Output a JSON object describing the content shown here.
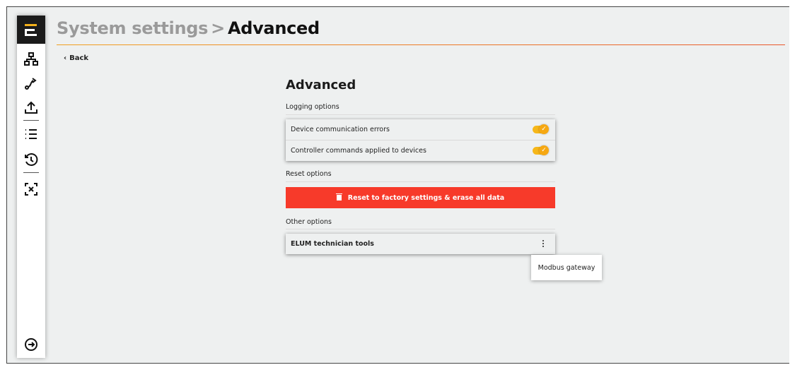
{
  "header": {
    "breadcrumb_parent": "System settings",
    "breadcrumb_separator": ">",
    "breadcrumb_current": "Advanced",
    "back_label": "Back",
    "back_icon": "chevron-left-icon"
  },
  "sidebar": {
    "logo": "E",
    "items": [
      {
        "icon": "network-hierarchy-icon"
      },
      {
        "icon": "route-icon"
      },
      {
        "icon": "upload-icon"
      },
      {
        "icon": "list-icon"
      },
      {
        "icon": "history-timer-icon"
      },
      {
        "icon": "scan-focus-icon"
      },
      {
        "icon": "logout-icon"
      }
    ]
  },
  "main": {
    "title": "Advanced",
    "logging": {
      "label": "Logging options",
      "items": [
        {
          "label": "Device communication errors",
          "enabled": true
        },
        {
          "label": "Controller commands applied to devices",
          "enabled": true
        }
      ]
    },
    "reset": {
      "label": "Reset options",
      "button_label": "Reset to factory settings & erase all data"
    },
    "other": {
      "label": "Other options",
      "tools_label": "ELUM technician tools"
    },
    "popup_menu": {
      "items": [
        "Modbus gateway"
      ]
    }
  },
  "colors": {
    "accent": "#f6b719",
    "danger": "#f73a2a",
    "background": "#eef0f0",
    "sidebar_logo_bg": "#1b1b1b"
  }
}
